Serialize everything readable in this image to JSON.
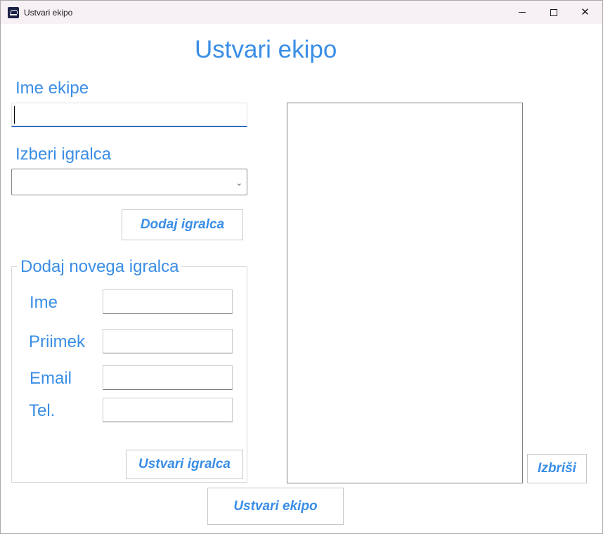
{
  "window": {
    "title": "Ustvari ekipo"
  },
  "heading": "Ustvari ekipo",
  "team": {
    "name_label": "Ime ekipe",
    "name_value": ""
  },
  "player_select": {
    "label": "Izberi igralca",
    "selected": ""
  },
  "buttons": {
    "add_player": "Dodaj igralca",
    "create_player": "Ustvari igralca",
    "delete": "Izbriši",
    "create_team": "Ustvari ekipo"
  },
  "new_player": {
    "legend": "Dodaj novega igralca",
    "fields": {
      "first_name": {
        "label": "Ime",
        "value": ""
      },
      "last_name": {
        "label": "Priimek",
        "value": ""
      },
      "email": {
        "label": "Email",
        "value": ""
      },
      "phone": {
        "label": "Tel.",
        "value": ""
      }
    }
  },
  "players_list": []
}
